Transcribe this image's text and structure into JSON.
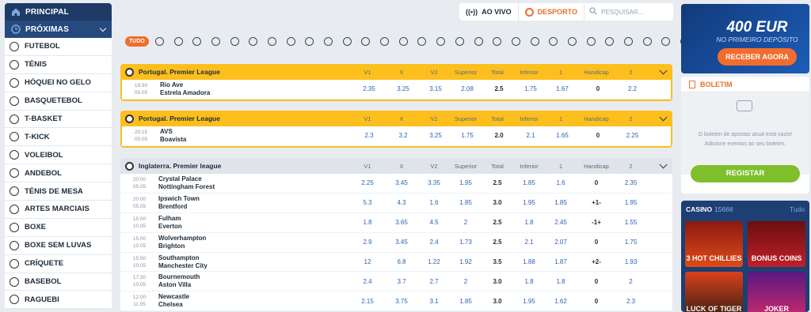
{
  "sidebar": {
    "principal": "PRINCIPAL",
    "proximas": "PRÓXIMAS",
    "sports": [
      "FUTEBOL",
      "TÉNIS",
      "HÓQUEI NO GELO",
      "BASQUETEBOL",
      "T-BASKET",
      "T-KICK",
      "VOLEIBOL",
      "ANDEBOL",
      "TÉNIS DE MESA",
      "ARTES MARCIAIS",
      "BOXE",
      "BOXE SEM LUVAS",
      "CRÍQUETE",
      "BASEBOL",
      "RAGUEBI"
    ]
  },
  "topbar": {
    "live": "AO VIVO",
    "sport": "DESPORTO",
    "search_placeholder": "PESQUISAR..."
  },
  "filter": {
    "all": "TUDO"
  },
  "columns": [
    "V1",
    "X",
    "V2",
    "Superior",
    "Total",
    "Inferior",
    "1",
    "Handicap",
    "2"
  ],
  "leagues": [
    {
      "name": "Portugal. Premier League",
      "style": "yellow",
      "matches": [
        {
          "time": "19:30",
          "date": "05.05",
          "home": "Rio Ave",
          "away": "Estrela Amadora",
          "odds": [
            "2.35",
            "3.25",
            "3.15",
            "2.08",
            "2.5",
            "1.75",
            "1.67",
            "0",
            "2.2"
          ]
        }
      ]
    },
    {
      "name": "Portugal. Premier League",
      "style": "yellow",
      "matches": [
        {
          "time": "20:15",
          "date": "05.05",
          "home": "AVS",
          "away": "Boavista",
          "odds": [
            "2.3",
            "3.2",
            "3.25",
            "1.75",
            "2.0",
            "2.1",
            "1.65",
            "0",
            "2.25"
          ]
        }
      ]
    },
    {
      "name": "Inglaterra. Premier league",
      "style": "grey",
      "matches": [
        {
          "time": "20:00",
          "date": "05.05",
          "home": "Crystal Palace",
          "away": "Nottingham Forest",
          "odds": [
            "2.25",
            "3.45",
            "3.35",
            "1.95",
            "2.5",
            "1.85",
            "1.6",
            "0",
            "2.35"
          ]
        },
        {
          "time": "20:00",
          "date": "05.05",
          "home": "Ipswich Town",
          "away": "Brentford",
          "odds": [
            "5.3",
            "4.3",
            "1.6",
            "1.85",
            "3.0",
            "1.95",
            "1.85",
            "+1-",
            "1.95"
          ]
        },
        {
          "time": "15:00",
          "date": "10.05",
          "home": "Fulham",
          "away": "Everton",
          "odds": [
            "1.8",
            "3.65",
            "4.5",
            "2",
            "2.5",
            "1.8",
            "2.45",
            "-1+",
            "1.55"
          ]
        },
        {
          "time": "15:00",
          "date": "10.05",
          "home": "Wolverhampton",
          "away": "Brighton",
          "odds": [
            "2.9",
            "3.45",
            "2.4",
            "1.73",
            "2.5",
            "2.1",
            "2.07",
            "0",
            "1.75"
          ]
        },
        {
          "time": "15:00",
          "date": "10.05",
          "home": "Southampton",
          "away": "Manchester City",
          "odds": [
            "12",
            "6.8",
            "1.22",
            "1.92",
            "3.5",
            "1.88",
            "1.87",
            "+2-",
            "1.93"
          ]
        },
        {
          "time": "17:30",
          "date": "10.05",
          "home": "Bournemouth",
          "away": "Aston Villa",
          "odds": [
            "2.4",
            "3.7",
            "2.7",
            "2",
            "3.0",
            "1.8",
            "1.8",
            "0",
            "2"
          ]
        },
        {
          "time": "12:00",
          "date": "11.05",
          "home": "Newcastle",
          "away": "Chelsea",
          "odds": [
            "2.15",
            "3.75",
            "3.1",
            "1.85",
            "3.0",
            "1.95",
            "1.62",
            "0",
            "2.3"
          ]
        }
      ]
    }
  ],
  "promo": {
    "amount": "400 EUR",
    "subtitle": "NO PRIMEIRO DEPÓSITO",
    "button": "RECEBER AGORA"
  },
  "boletim": {
    "title": "BOLETIM",
    "empty1": "O boletim de apostas atual está vazio!",
    "empty2": "Adicione eventos ao seu boletim.",
    "register": "REGISTAR"
  },
  "casino": {
    "title": "CASINO",
    "count": "15666",
    "all": "Tudo",
    "games": [
      "3 HOT CHILLIES",
      "BONUS COINS",
      "LUCK OF TIGER",
      "JOKER"
    ]
  }
}
